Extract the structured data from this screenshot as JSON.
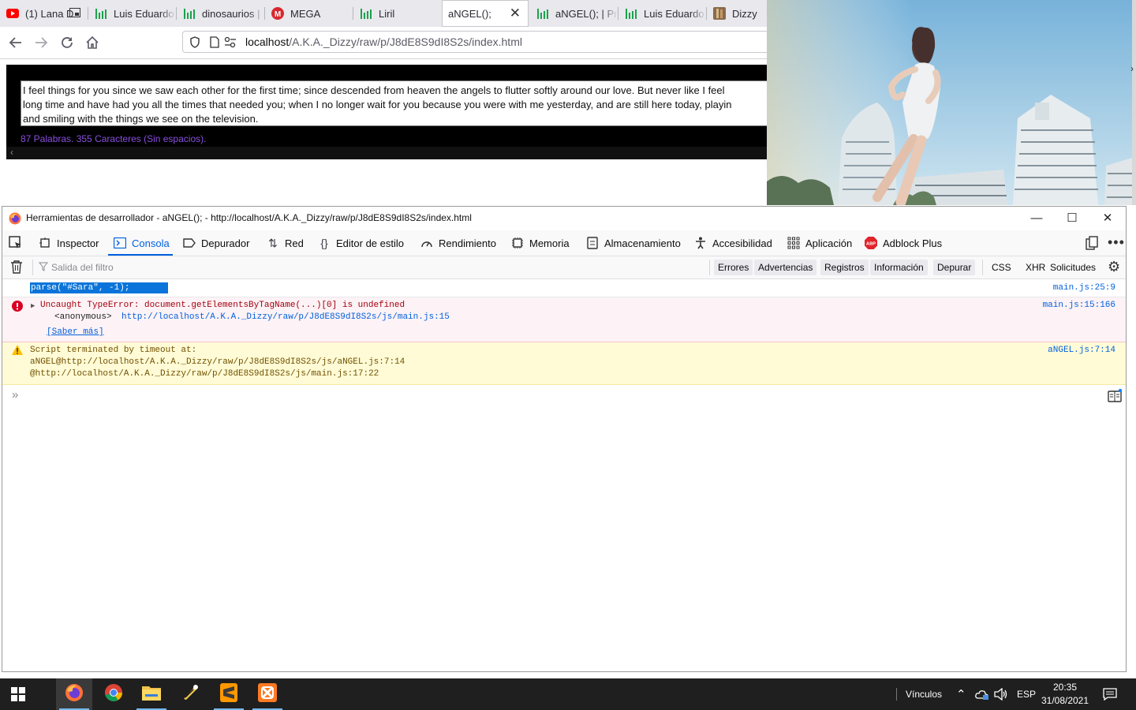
{
  "browser": {
    "tabs": [
      {
        "label": "(1) Lana D",
        "icon": "youtube-icon"
      },
      {
        "label": "Luis Eduardo",
        "icon": "bar-chart-icon"
      },
      {
        "label": "dinosaurios |",
        "icon": "bar-chart-icon"
      },
      {
        "label": "MEGA",
        "icon": "mega-icon"
      },
      {
        "label": "Liril",
        "icon": "bar-chart-icon"
      },
      {
        "label": "aNGEL();",
        "icon": "none",
        "active": true
      },
      {
        "label": "aNGEL(); | Pr",
        "icon": "bar-chart-icon"
      },
      {
        "label": "Luis Eduardo",
        "icon": "bar-chart-icon"
      },
      {
        "label": "Dizzy",
        "icon": "image-icon"
      }
    ],
    "url_host": "localhost",
    "url_path": "/A.K.A._Dizzy/raw/p/J8dE8S9dI8S2s/index.html"
  },
  "page": {
    "text_lines": [
      "I feel things for you since we saw each other for the first time; since descended from heaven the angels to flutter softly around our love. But never like I feel",
      "long time and have had you all the times that needed you; when I no longer wait for you because you were with me yesterday, and are still here today, playin",
      "and smiling with the things we see on the television."
    ],
    "word_count": "87 Palabras. 355 Caracteres (Sin espacios)."
  },
  "devtools": {
    "title": "Herramientas de desarrollador - aNGEL(); - http://localhost/A.K.A._Dizzy/raw/p/J8dE8S9dI8S2s/index.html",
    "tabs": [
      {
        "label": "Inspector",
        "icon": "inspector-icon"
      },
      {
        "label": "Consola",
        "icon": "console-icon",
        "active": true
      },
      {
        "label": "Depurador",
        "icon": "debugger-icon"
      },
      {
        "label": "Red",
        "icon": "network-icon"
      },
      {
        "label": "Editor de estilo",
        "icon": "style-editor-icon"
      },
      {
        "label": "Rendimiento",
        "icon": "performance-icon"
      },
      {
        "label": "Memoria",
        "icon": "memory-icon"
      },
      {
        "label": "Almacenamiento",
        "icon": "storage-icon"
      },
      {
        "label": "Accesibilidad",
        "icon": "accessibility-icon"
      },
      {
        "label": "Aplicación",
        "icon": "application-icon"
      },
      {
        "label": "Adblock Plus",
        "icon": "adblock-icon"
      }
    ],
    "filter_placeholder": "Salida del filtro",
    "filters": [
      "Errores",
      "Advertencias",
      "Registros",
      "Información",
      "Depurar"
    ],
    "extra_filters": [
      "CSS",
      "XHR",
      "Solicitudes"
    ],
    "console": {
      "input_echo": "parse(\"#Sara\", -1);",
      "input_src": "main.js:25:9",
      "error_message": "Uncaught TypeError: document.getElementsByTagName(...)[0] is undefined",
      "error_src": "main.js:15:166",
      "error_frame_fn": "<anonymous>",
      "error_frame_url": "http://localhost/A.K.A._Dizzy/raw/p/J8dE8S9dI8S2s/js/main.js:15",
      "error_learn_more": "[Saber más]",
      "warn_message": "Script terminated by timeout at:",
      "warn_frame_1": "aNGEL@http://localhost/A.K.A._Dizzy/raw/p/J8dE8S9dI8S2s/js/aNGEL.js:7:14",
      "warn_frame_2": "@http://localhost/A.K.A._Dizzy/raw/p/J8dE8S9dI8S2s/js/main.js:17:22",
      "warn_src": "aNGEL.js:7:14"
    }
  },
  "taskbar": {
    "links_label": "Vínculos",
    "language": "ESP",
    "time": "20:35",
    "date": "31/08/2021"
  },
  "colors": {
    "devtools_accent": "#0060df",
    "error_bg": "#fdf2f5",
    "warning_bg": "#fffbd6",
    "word_count_text": "#8a4fe0"
  }
}
